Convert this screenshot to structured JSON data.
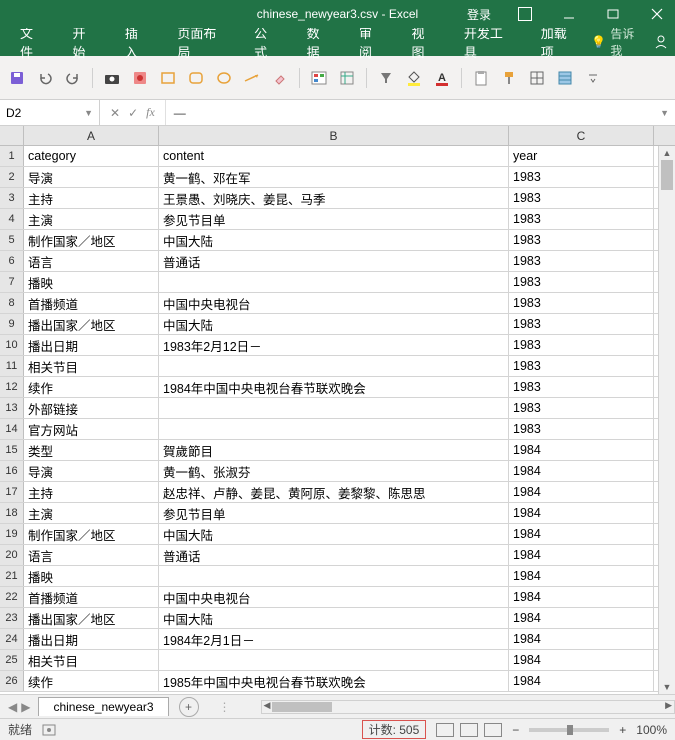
{
  "title": "chinese_newyear3.csv - Excel",
  "login": "登录",
  "ribbon": {
    "tabs": [
      "文件",
      "开始",
      "插入",
      "页面布局",
      "公式",
      "数据",
      "审阅",
      "视图",
      "开发工具",
      "加载项"
    ],
    "tell_me": "告诉我"
  },
  "namebox": "D2",
  "formula": "—",
  "columns": [
    "A",
    "B",
    "C"
  ],
  "headers": {
    "A": "category",
    "B": "content",
    "C": "year"
  },
  "rows": [
    {
      "n": 1,
      "A": "category",
      "B": "content",
      "C": "year"
    },
    {
      "n": 2,
      "A": "导演",
      "B": "黄一鹤、邓在军",
      "C": "1983"
    },
    {
      "n": 3,
      "A": "主持",
      "B": "王景愚、刘晓庆、姜昆、马季",
      "C": "1983"
    },
    {
      "n": 4,
      "A": "主演",
      "B": "参见节目单",
      "C": "1983"
    },
    {
      "n": 5,
      "A": "制作国家／地区",
      "B": "中国大陆",
      "C": "1983"
    },
    {
      "n": 6,
      "A": "语言",
      "B": "普通话",
      "C": "1983"
    },
    {
      "n": 7,
      "A": "播映",
      "B": "",
      "C": "1983"
    },
    {
      "n": 8,
      "A": "首播频道",
      "B": "中国中央电视台",
      "C": "1983"
    },
    {
      "n": 9,
      "A": "播出国家／地区",
      "B": "中国大陆",
      "C": "1983"
    },
    {
      "n": 10,
      "A": "播出日期",
      "B": "1983年2月12日－",
      "C": "1983"
    },
    {
      "n": 11,
      "A": "相关节目",
      "B": "",
      "C": "1983"
    },
    {
      "n": 12,
      "A": "续作",
      "B": "1984年中国中央电视台春节联欢晚会",
      "C": "1983"
    },
    {
      "n": 13,
      "A": "外部链接",
      "B": "",
      "C": "1983"
    },
    {
      "n": 14,
      "A": "官方网站",
      "B": "",
      "C": "1983"
    },
    {
      "n": 15,
      "A": "类型",
      "B": "賀歲節目",
      "C": "1984"
    },
    {
      "n": 16,
      "A": "导演",
      "B": "黄一鹤、张淑芬",
      "C": "1984"
    },
    {
      "n": 17,
      "A": "主持",
      "B": "赵忠祥、卢静、姜昆、黄阿原、姜黎黎、陈思思",
      "C": "1984"
    },
    {
      "n": 18,
      "A": "主演",
      "B": "参见节目单",
      "C": "1984"
    },
    {
      "n": 19,
      "A": "制作国家／地区",
      "B": "中国大陆",
      "C": "1984"
    },
    {
      "n": 20,
      "A": "语言",
      "B": "普通话",
      "C": "1984"
    },
    {
      "n": 21,
      "A": "播映",
      "B": "",
      "C": "1984"
    },
    {
      "n": 22,
      "A": "首播频道",
      "B": "中国中央电视台",
      "C": "1984"
    },
    {
      "n": 23,
      "A": "播出国家／地区",
      "B": "中国大陆",
      "C": "1984"
    },
    {
      "n": 24,
      "A": "播出日期",
      "B": "1984年2月1日－",
      "C": "1984"
    },
    {
      "n": 25,
      "A": "相关节目",
      "B": "",
      "C": "1984"
    },
    {
      "n": 26,
      "A": "续作",
      "B": "1985年中国中央电视台春节联欢晚会",
      "C": "1984"
    }
  ],
  "sheet_name": "chinese_newyear3",
  "status": {
    "ready": "就绪",
    "count_label": "计数: 505",
    "zoom": "100%"
  }
}
